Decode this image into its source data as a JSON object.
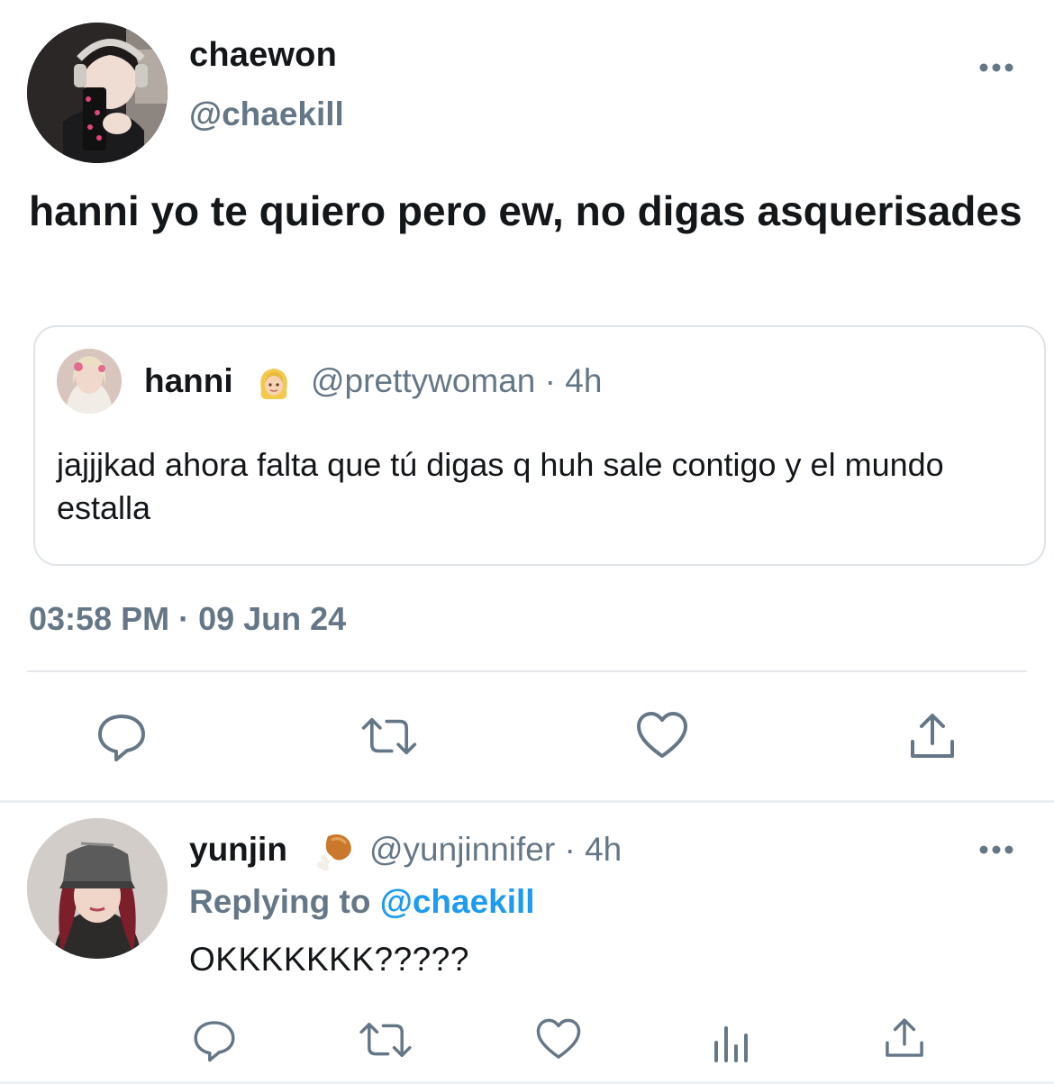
{
  "tweet": {
    "author": {
      "display_name": "chaewon",
      "handle": "@chaekill"
    },
    "text": "hanni yo te quiero pero ew, no digas asquerisades",
    "timestamp": "03:58 PM · 09 Jun 24",
    "more_icon": "ellipsis-icon"
  },
  "quote": {
    "author": {
      "display_name": "hanni",
      "emoji": "👱‍♀️",
      "handle_time": "@prettywoman · 4h"
    },
    "text": "jajjjkad ahora falta que tú digas q huh sale contigo y el mundo estalla"
  },
  "actions": [
    {
      "icon": "reply-icon"
    },
    {
      "icon": "retweet-icon"
    },
    {
      "icon": "heart-icon"
    },
    {
      "icon": "share-icon"
    }
  ],
  "reply": {
    "author": {
      "display_name": "yunjin",
      "emoji": "🍗",
      "handle_time": "@yunjinnifer · 4h"
    },
    "replying_prefix": "Replying to",
    "replying_mention": "@chaekill",
    "text": "OKKKKKKK?????",
    "actions": [
      {
        "icon": "reply-icon"
      },
      {
        "icon": "retweet-icon"
      },
      {
        "icon": "heart-icon"
      },
      {
        "icon": "analytics-icon"
      },
      {
        "icon": "share-icon"
      }
    ]
  },
  "colors": {
    "primary_text": "#14171a",
    "secondary_text": "#657786",
    "link": "#1d9bf0",
    "border": "#dfe4e8"
  }
}
